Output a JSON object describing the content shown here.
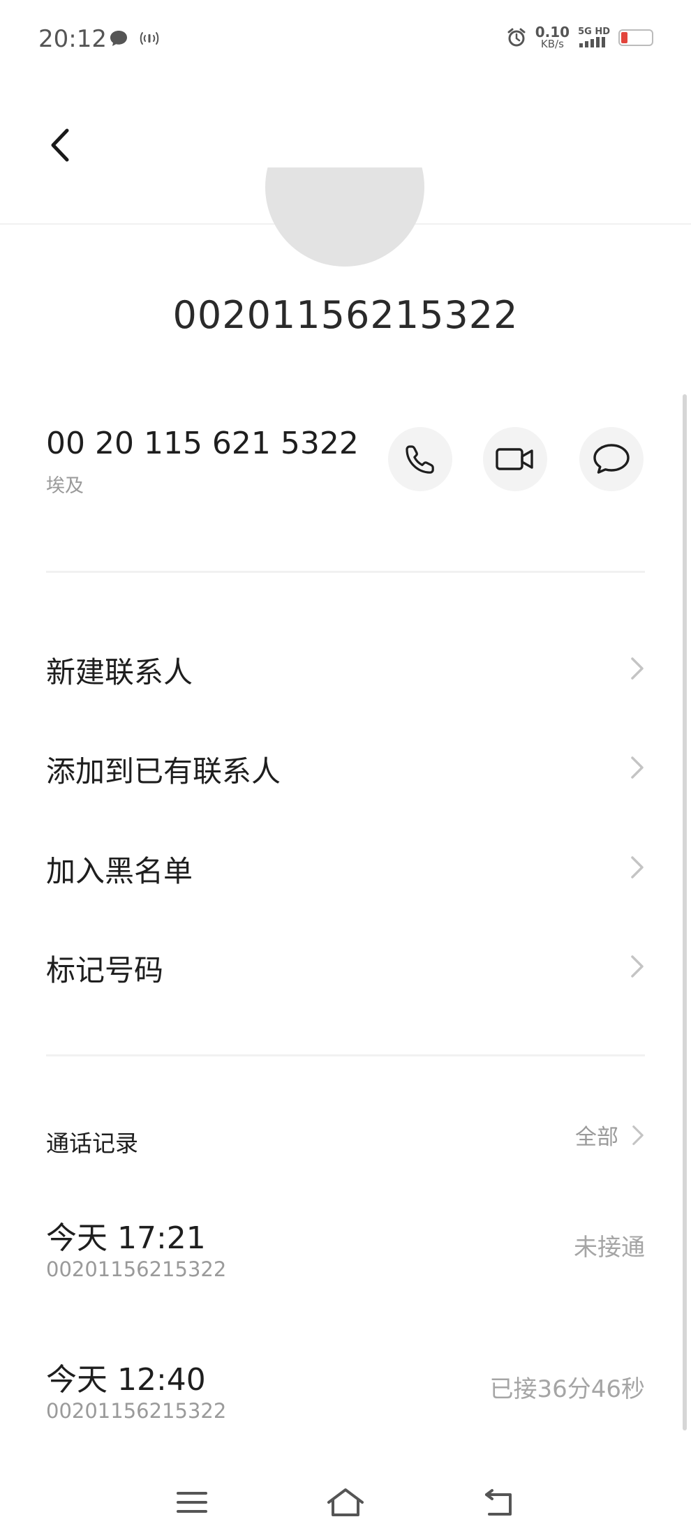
{
  "status_bar": {
    "time": "20:12",
    "net_speed_value": "0.10",
    "net_speed_unit": "KB/s",
    "signal_label": "5G HD",
    "icons": [
      "chat-bubble-icon",
      "nfc-icon",
      "alarm-icon",
      "signal-icon",
      "battery-icon"
    ],
    "battery_color": "#e2453c"
  },
  "header": {
    "back_icon": "chevron-left-icon"
  },
  "contact": {
    "number": "00201156215322",
    "formatted_number": "00 20 115 621 5322",
    "location": "埃及",
    "actions": [
      "phone-icon",
      "video-call-icon",
      "message-icon"
    ]
  },
  "menu": [
    {
      "label": "新建联系人"
    },
    {
      "label": "添加到已有联系人"
    },
    {
      "label": "加入黑名单"
    },
    {
      "label": "标记号码"
    }
  ],
  "call_log": {
    "title": "通话记录",
    "all_label": "全部",
    "entries": [
      {
        "time": "今天 17:21",
        "number": "00201156215322",
        "status": "未接通"
      },
      {
        "time": "今天 12:40",
        "number": "00201156215322",
        "status": "已接36分46秒"
      }
    ]
  },
  "nav": {
    "icons": [
      "menu-icon",
      "home-icon",
      "back-icon"
    ]
  }
}
